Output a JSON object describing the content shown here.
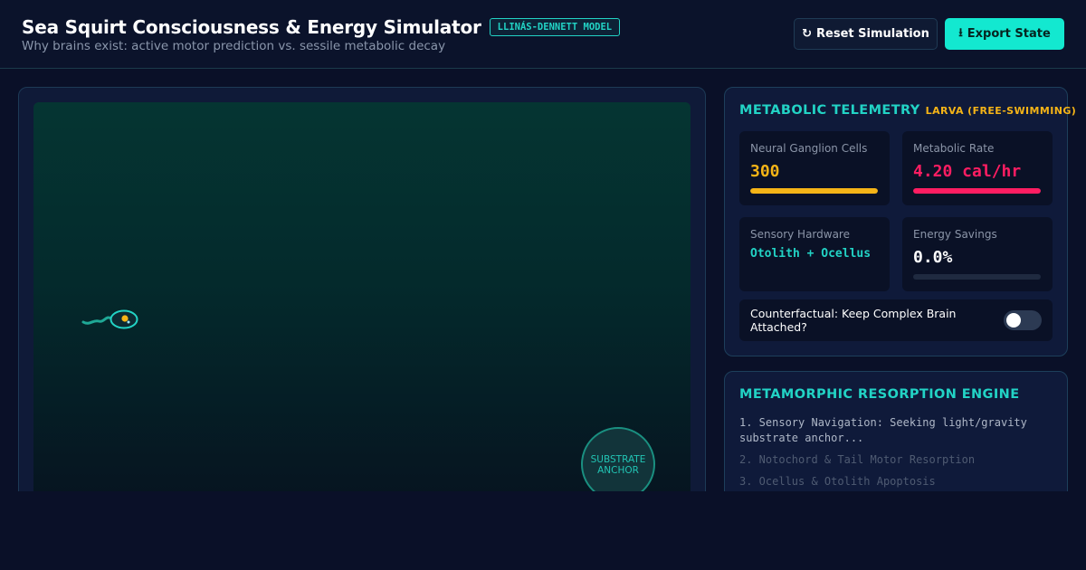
{
  "header": {
    "title": "Sea Squirt Consciousness & Energy Simulator",
    "badge": "LLINÁS-DENNETT MODEL",
    "subtitle": "Why brains exist: active motor prediction vs. sessile metabolic decay",
    "reset_icon": "↻",
    "reset_label": "Reset Simulation",
    "export_icon": "⭳",
    "export_label": "Export State"
  },
  "simulation": {
    "anchor_label": "SUBSTRATE ANCHOR"
  },
  "telemetry": {
    "title": "METABOLIC TELEMETRY",
    "stage": "LARVA (FREE-SWIMMING)",
    "cards": {
      "neurons": {
        "label": "Neural Ganglion Cells",
        "value": "300",
        "fill": 1.0,
        "color": "#f5b417"
      },
      "metabolic": {
        "label": "Metabolic Rate",
        "value": "4.20 cal/hr",
        "fill": 1.0,
        "color": "#ff1d62"
      },
      "sensory": {
        "label": "Sensory Hardware",
        "value": "Otolith + Ocellus",
        "color": "#22d3c5"
      },
      "savings": {
        "label": "Energy Savings",
        "value": "0.0%",
        "fill": 0.0,
        "color": "#ffffff"
      }
    },
    "counterfactual": {
      "label": "Counterfactual: Keep Complex Brain Attached?",
      "enabled": false
    }
  },
  "engine": {
    "title": "METAMORPHIC RESORPTION ENGINE",
    "steps": [
      {
        "text": "1. Sensory Navigation: Seeking light/gravity substrate anchor...",
        "state": "active"
      },
      {
        "text": "2. Notochord & Tail Motor Resorption",
        "state": "pending"
      },
      {
        "text": "3. Ocellus & Otolith Apoptosis",
        "state": "pending"
      }
    ]
  }
}
